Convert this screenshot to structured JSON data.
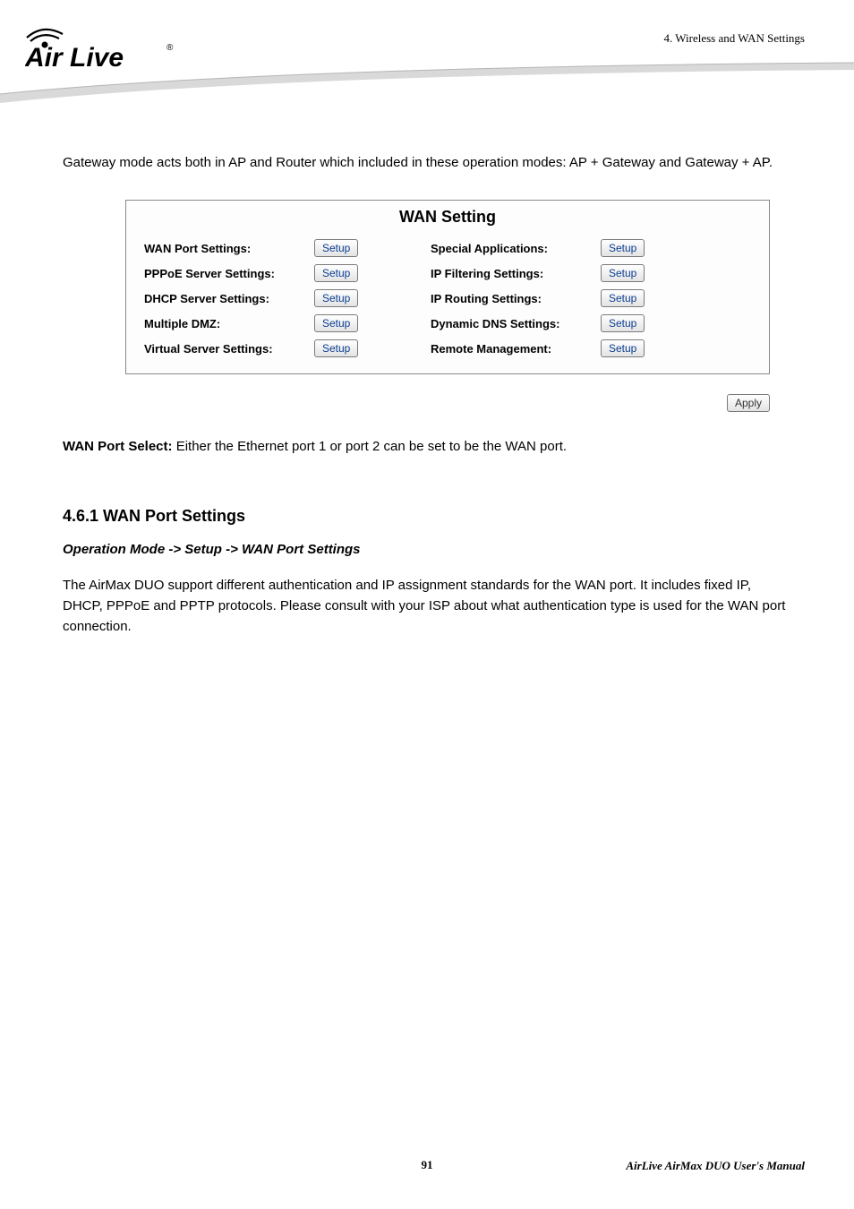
{
  "header": {
    "chapter": "4. Wireless and WAN Settings",
    "logo_text": "Air Live",
    "logo_reg": "®"
  },
  "intro": "Gateway mode acts both in AP and Router which included in these operation modes: AP + Gateway and Gateway + AP.",
  "wan_panel": {
    "title": "WAN Setting",
    "rows": [
      {
        "left_label": "WAN Port Settings:",
        "right_label": "Special Applications:"
      },
      {
        "left_label": "PPPoE Server Settings:",
        "right_label": "IP Filtering Settings:"
      },
      {
        "left_label": "DHCP Server Settings:",
        "right_label": "IP Routing Settings:"
      },
      {
        "left_label": "Multiple DMZ:",
        "right_label": "Dynamic DNS Settings:"
      },
      {
        "left_label": "Virtual Server Settings:",
        "right_label": "Remote Management:"
      }
    ],
    "setup_btn": "Setup",
    "apply_btn": "Apply"
  },
  "wan_port_select": {
    "label": "WAN Port Select:",
    "text": " Either the Ethernet port 1 or port 2 can be set to be the WAN port."
  },
  "section": {
    "heading": "4.6.1  WAN Port Settings",
    "subheading": "Operation Mode -> Setup -> WAN Port Settings",
    "para": "The AirMax DUO support different authentication and IP assignment standards for the WAN port. It includes fixed IP, DHCP, PPPoE and PPTP protocols. Please consult with your ISP about what authentication type is used for the WAN port connection."
  },
  "footer": {
    "page": "91",
    "manual": "AirLive AirMax DUO User's Manual"
  }
}
